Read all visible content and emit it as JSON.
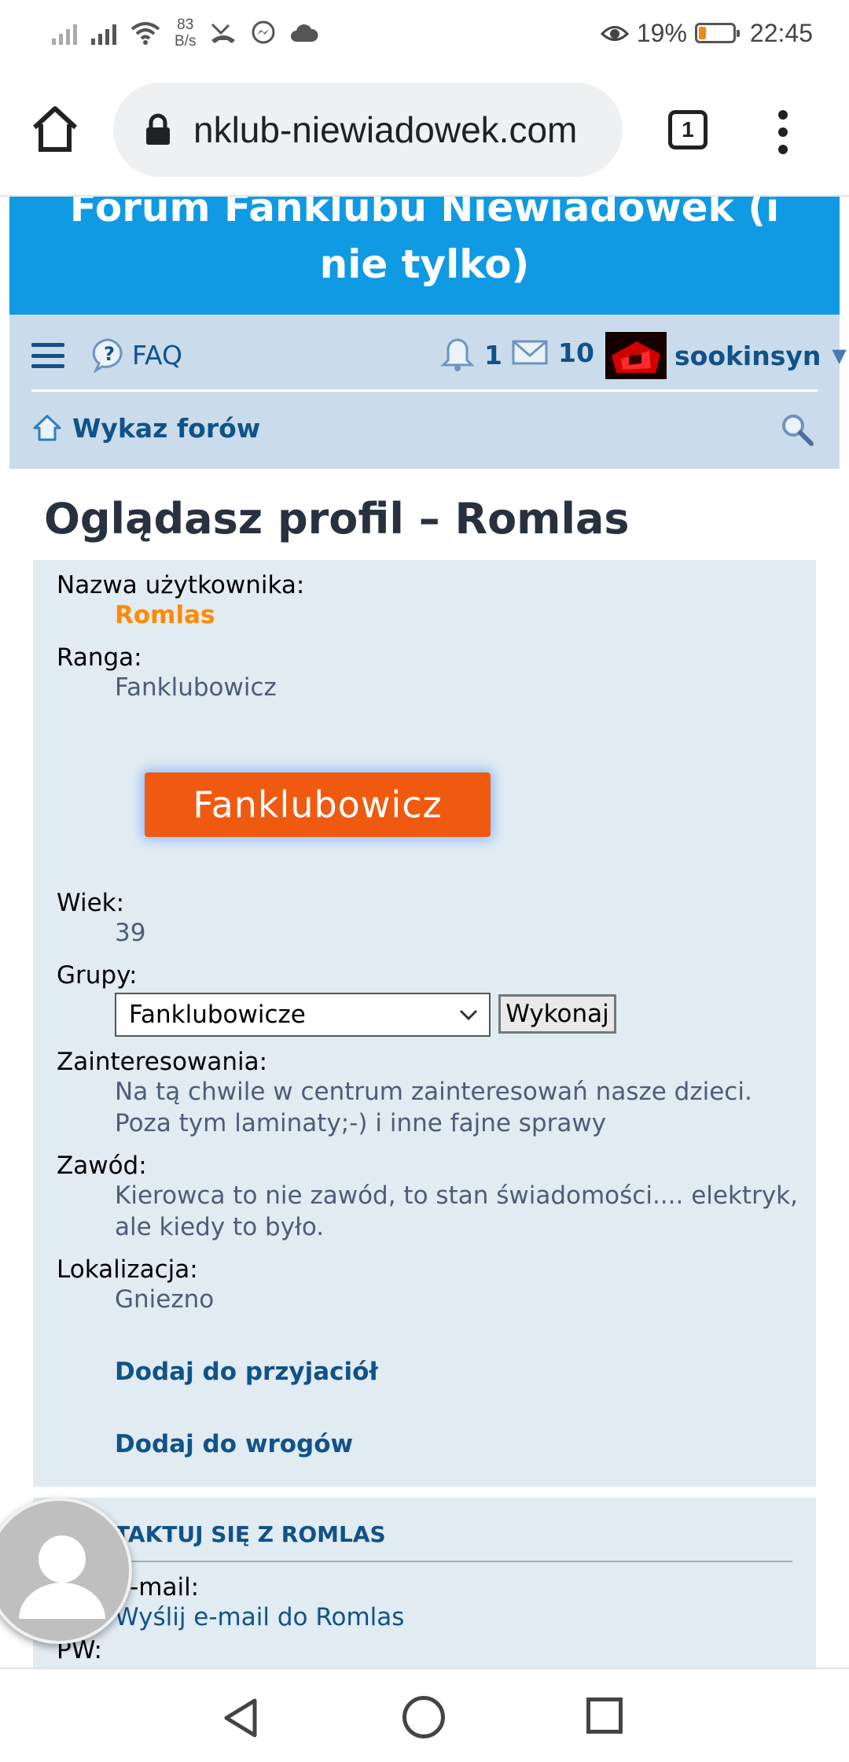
{
  "status_bar": {
    "net_speed_value": "83",
    "net_speed_unit": "B/s",
    "battery_percent": "19%",
    "battery_level": 0.19,
    "time": "22:45",
    "colors": {
      "battery_fill": "#f08a13"
    }
  },
  "browser": {
    "url": "nklub-niewiadowek.com",
    "tab_count": "1",
    "icons": [
      "home-icon",
      "lock-icon",
      "tabs-icon",
      "more-vert-icon"
    ]
  },
  "site": {
    "title": "Forum Fanklubu Niewiadowek (i nie tylko)",
    "accent_color": "#0f9ae3"
  },
  "nav": {
    "faq_label": "FAQ",
    "notifications_count": "1",
    "messages_count": "10",
    "username": "sookinsyn",
    "home_link": "Wykaz forów"
  },
  "profile": {
    "page_title": "Oglądasz profil – Romlas",
    "username_label": "Nazwa użytkownika:",
    "username_value": "Romlas",
    "rank_label": "Ranga:",
    "rank_value": "Fanklubowicz",
    "rank_image_text": "Fanklubowicz",
    "age_label": "Wiek:",
    "age_value": "39",
    "groups_label": "Grupy:",
    "groups_selected": "Fanklubowicze",
    "groups_button": "Wykonaj",
    "interests_label": "Zainteresowania:",
    "interests_value": "Na tą chwile w centrum zainteresowań nasze dzieci. Poza tym laminaty;-) i inne fajne sprawy",
    "occupation_label": "Zawód:",
    "occupation_value": "Kierowca to nie zawód, to stan świadomości.... elektryk, ale kiedy to było.",
    "location_label": "Lokalizacja:",
    "location_value": "Gniezno",
    "add_friend": "Dodaj do przyjaciół",
    "add_foe": "Dodaj do wrogów"
  },
  "contact": {
    "title": "TAKTUJ SIĘ Z ROMLAS",
    "email_label": "e-mail:",
    "email_link": "Wyślij e-mail do Romlas",
    "pm_label": "PW:"
  }
}
